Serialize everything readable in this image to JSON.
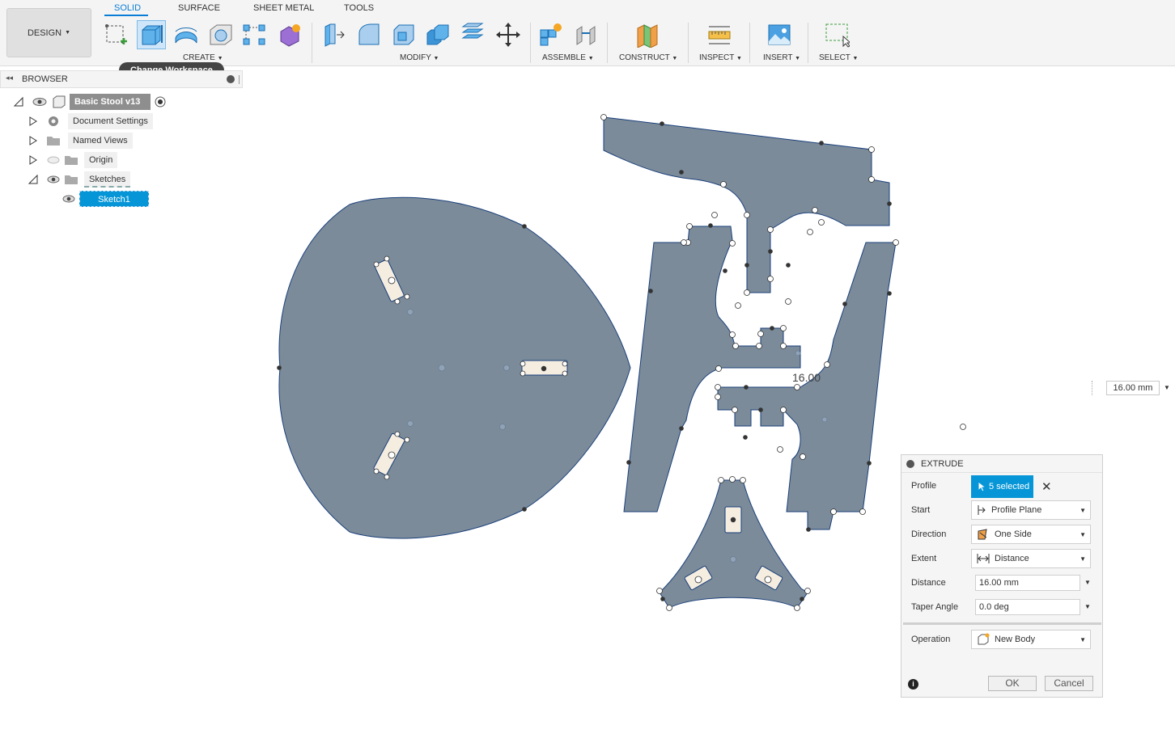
{
  "toolbar": {
    "design_label": "DESIGN",
    "tabs": [
      {
        "label": "SOLID",
        "active": true
      },
      {
        "label": "SURFACE"
      },
      {
        "label": "SHEET METAL"
      },
      {
        "label": "TOOLS"
      }
    ],
    "groups": {
      "create": "CREATE",
      "modify": "MODIFY",
      "assemble": "ASSEMBLE",
      "construct": "CONSTRUCT",
      "inspect": "INSPECT",
      "insert": "INSERT",
      "select": "SELECT"
    },
    "tooltip": "Change Workspace",
    "accent": "#0a7ed6"
  },
  "browser": {
    "title": "BROWSER",
    "root": "Basic Stool v13",
    "items": [
      {
        "label": "Document Settings"
      },
      {
        "label": "Named Views"
      },
      {
        "label": "Origin"
      },
      {
        "label": "Sketches"
      },
      {
        "label": "Sketch1"
      }
    ]
  },
  "canvas": {
    "dimension_text": "16.00",
    "distance_value": "16.00 mm",
    "profile_color": "#7b8b9a"
  },
  "extrude": {
    "title": "EXTRUDE",
    "profile_label": "Profile",
    "profile_value": "5 selected",
    "start_label": "Start",
    "start_value": "Profile Plane",
    "direction_label": "Direction",
    "direction_value": "One Side",
    "extent_label": "Extent",
    "extent_value": "Distance",
    "distance_label": "Distance",
    "distance_value": "16.00 mm",
    "taper_label": "Taper Angle",
    "taper_value": "0.0 deg",
    "operation_label": "Operation",
    "operation_value": "New Body",
    "ok_label": "OK",
    "cancel_label": "Cancel"
  }
}
